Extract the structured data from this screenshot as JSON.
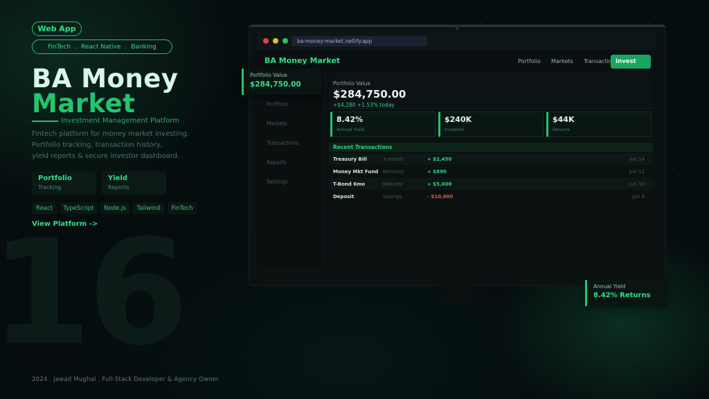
{
  "hero": {
    "badge": "Web App",
    "tags": [
      "FinTech",
      "React Native",
      "Banking"
    ],
    "tag_separator": ".",
    "title_line1": "BA Money",
    "title_line2": "Market",
    "subtitle": "Investment Management Platform",
    "description": [
      "Fintech platform for money market investing.",
      "Portfolio tracking, transaction history,",
      "yield reports & secure investor dashboard."
    ],
    "features": [
      {
        "title": "Portfolio",
        "sub": "Tracking"
      },
      {
        "title": "Yield",
        "sub": "Reports"
      }
    ],
    "tech": [
      "React",
      "TypeScript",
      "Node.js",
      "Tailwind",
      "FinTech"
    ],
    "cta": "View Platform  ->",
    "background_number": "16"
  },
  "footer": {
    "text": "2024  .  Jawad Mughal  .  Full-Stack Developer & Agency Owner"
  },
  "browser": {
    "url": "ba-money-market.netlify.app",
    "traffic_colors": [
      "#e0453c",
      "#e8b92c",
      "#2ec45e"
    ]
  },
  "app": {
    "brand": "BA Money Market",
    "nav": [
      "Portfolio",
      "Markets",
      "Transactions"
    ],
    "invest_button": "Invest",
    "sidebar": [
      "Portfolio",
      "Markets",
      "Transactions",
      "Reports",
      "Settings"
    ],
    "portfolio": {
      "label": "Portfolio Value",
      "value": "$284,750.00",
      "change": "+$4,280  +1.53% today"
    },
    "stats": [
      {
        "value": "8.42%",
        "label": "Annual Yield"
      },
      {
        "value": "$240K",
        "label": "Invested"
      },
      {
        "value": "$44K",
        "label": "Returns"
      }
    ],
    "transactions_title": "Recent Transactions",
    "transactions": [
      {
        "name": "Treasury Bill",
        "type": "3-month",
        "amount": "+ $2,450",
        "date": "Jun 14",
        "sign": "pos"
      },
      {
        "name": "Money Mkt Fund",
        "type": "Reinvest",
        "amount": "+ $890",
        "date": "Jun 12",
        "sign": "pos"
      },
      {
        "name": "T-Bond 6mo",
        "type": "Matured",
        "amount": "+ $5,600",
        "date": "Jun 10",
        "sign": "pos"
      },
      {
        "name": "Deposit",
        "type": "Savings",
        "amount": "- $10,000",
        "date": "Jun 8",
        "sign": "neg"
      }
    ]
  },
  "floating": {
    "left_label": "Portfolio Value",
    "left_value": "$284,750.00",
    "right_label": "Annual Yield",
    "right_value": "8.42% Returns"
  },
  "colors": {
    "accent": "#22c56f",
    "background": "#060d0e",
    "negative": "#d85c4f"
  }
}
